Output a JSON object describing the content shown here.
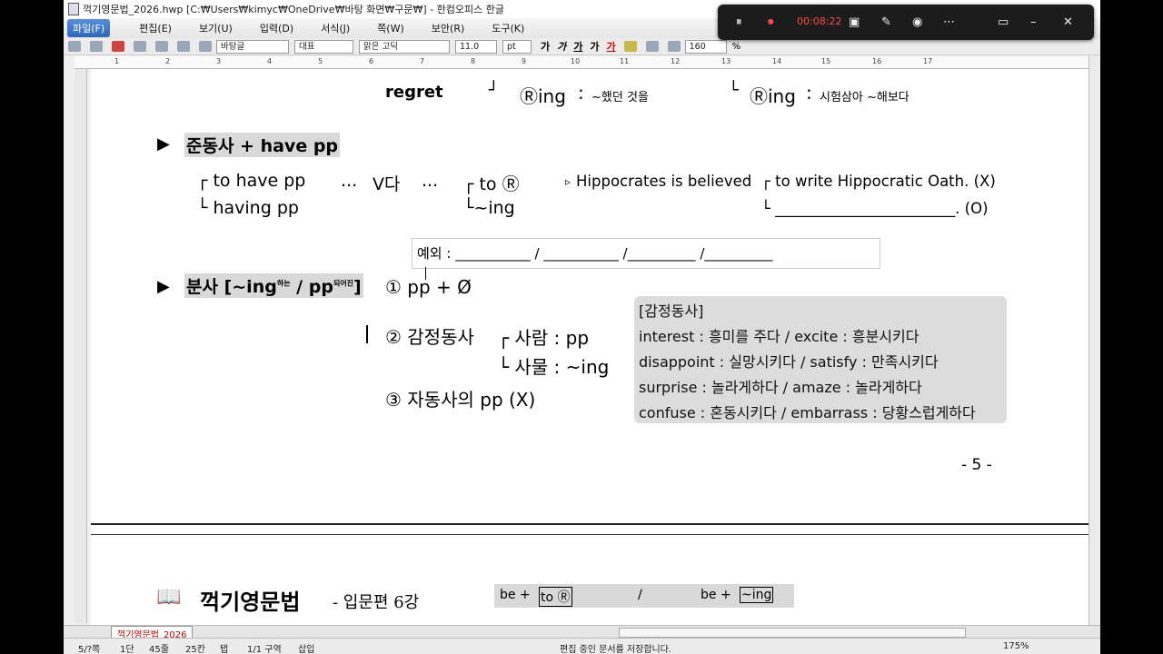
{
  "titlebar": {
    "title": "꺽기영문법_2026.hwp [C:₩Users₩kimyc₩OneDrive₩바탕 화면₩구문₩] - 한컴오피스 한글"
  },
  "menu": [
    "파일(F)",
    "편집(E)",
    "보기(U)",
    "입력(D)",
    "서식(J)",
    "쪽(W)",
    "보안(R)",
    "도구(K)"
  ],
  "toolbar": {
    "style": "바탕글",
    "font_group": "대표",
    "font": "맑은 고딕",
    "size": "11.0",
    "size_unit": "pt",
    "zoom": "160",
    "zoom_unit": "%",
    "fmt": [
      "가",
      "가",
      "가",
      "가",
      "가"
    ]
  },
  "recorder": {
    "timer": "00:08:22"
  },
  "ruler": [
    "1",
    "2",
    "3",
    "4",
    "5",
    "6",
    "7",
    "8",
    "9",
    "10",
    "11",
    "12",
    "13",
    "14",
    "15",
    "16",
    "17"
  ],
  "doc": {
    "regret": "regret",
    "corner1": "┘",
    "r_ing1": "Ⓡing",
    "colon": ":",
    "r_ing1_meaning": "~했던 것을",
    "corner2": "└",
    "r_ing2": "Ⓡing",
    "r_ing2_meaning": "시험삼아 ~해보다",
    "sec1_marker": "▶",
    "sec1_title": "준동사 + have pp",
    "to_have_pp": "┌ to have pp",
    "dots": "...",
    "vda": "V다",
    "to_r": "┌ to Ⓡ",
    "having_pp": "└ having pp",
    "ing": "└~ing",
    "hippo_marker": "▹",
    "hippo": "Hippocrates is believed",
    "to_write": "┌ to write Hippocratic Oath. (X)",
    "blank_line": "└ ________________________. (O)",
    "exception": "예외 : ___________ / ___________ /__________ /__________",
    "sec2_marker": "▶",
    "sec2_title_main": "분사 [~ing",
    "sec2_sub1": "하는",
    "sec2_mid": " / pp",
    "sec2_sub2": "되어진",
    "sec2_close": "]",
    "item1": "① pp + Ø",
    "item2": "② 감정동사",
    "person": "┌ 사람 : pp",
    "thing": "└ 사물 : ~ing",
    "item3": "③ 자동사의 pp (X)",
    "card_title": "[감정동사]",
    "card_lines": [
      "interest : 흥미를 주다 / excite : 흥분시키다",
      "disappoint : 실망시키다 / satisfy : 만족시키다",
      "surprise : 놀라게하다 / amaze : 놀라게하다",
      "confuse : 혼동시키다 / embarrass : 당황스럽게하다"
    ],
    "page_number": "- 5 -"
  },
  "page2": {
    "book_icon": "📖",
    "logo": "꺽기영문법",
    "subtitle": "- 입문편 6강",
    "box_be1": "be +",
    "box_to_r": "to Ⓡ",
    "box_slash": "/",
    "box_be2": "be +",
    "box_ing": "~ing"
  },
  "tab": {
    "label": "꺽기영문법_2026"
  },
  "status": {
    "page": "5/?쪽",
    "col": "1단",
    "line": "45줄",
    "char": "25칸",
    "tab": "탭",
    "section": "1/1 구역",
    "insert": "삽입",
    "message": "편집 중인 문서를 저장합니다.",
    "zoom": "175%"
  }
}
